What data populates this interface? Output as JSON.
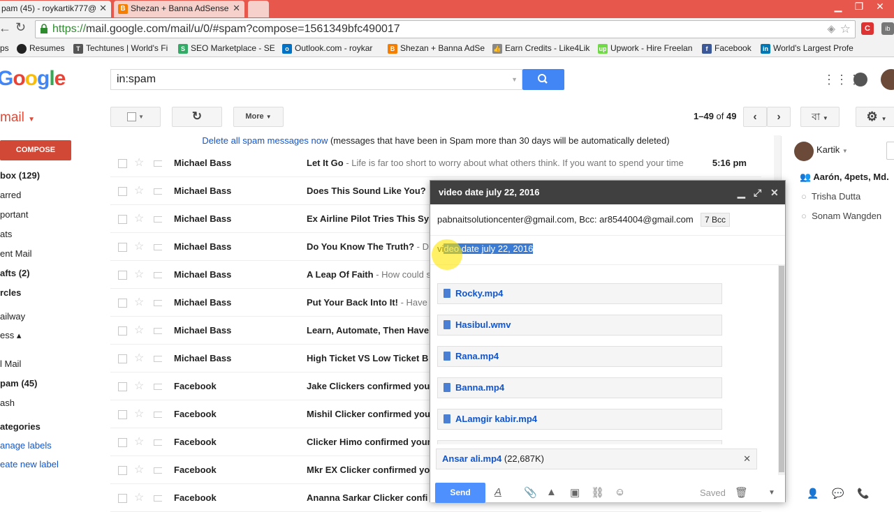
{
  "browser": {
    "tabs": [
      {
        "title": "pam (45) - roykartik777@"
      },
      {
        "title": "Shezan + Banna AdSense"
      },
      {
        "title": ""
      }
    ],
    "url_scheme": "https://",
    "url_rest": "mail.google.com/mail/u/0/#spam?compose=1561349bfc490017",
    "bookmarks": [
      {
        "label": "ps",
        "icon": "apps-icon"
      },
      {
        "label": "Resumes",
        "icon": "resumes-icon"
      },
      {
        "label": "Techtunes | World's Fi",
        "icon": "techtunes-icon"
      },
      {
        "label": "SEO Marketplace - SE",
        "icon": "seo-icon"
      },
      {
        "label": "Outlook.com - roykar",
        "icon": "outlook-icon"
      },
      {
        "label": "Shezan + Banna AdSe",
        "icon": "blogger-icon"
      },
      {
        "label": "Earn Credits - Like4Lik",
        "icon": "like-icon"
      },
      {
        "label": "Upwork - Hire Freelan",
        "icon": "upwork-icon"
      },
      {
        "label": "Facebook",
        "icon": "facebook-icon"
      },
      {
        "label": "World's Largest Profe",
        "icon": "linkedin-icon"
      }
    ]
  },
  "gmail": {
    "logo": "oogle",
    "product_label": "mail",
    "search_value": "in:spam",
    "toolbar": {
      "more": "More",
      "range": "1–49",
      "of": "of",
      "total": "49",
      "lang": "বা"
    },
    "compose_label": "COMPOSE",
    "nav": [
      {
        "label": "box (129)",
        "bold": true
      },
      {
        "label": "arred",
        "bold": false
      },
      {
        "label": "portant",
        "bold": false
      },
      {
        "label": "ats",
        "bold": false
      },
      {
        "label": "ent Mail",
        "bold": false
      },
      {
        "label": "afts (2)",
        "bold": true
      },
      {
        "label": "rcles",
        "bold": true
      },
      {
        "label": "ailway",
        "bold": false
      },
      {
        "label": "ess ▴",
        "bold": false
      },
      {
        "label": "l Mail",
        "bold": false
      },
      {
        "label": "pam (45)",
        "bold": true
      },
      {
        "label": "ash",
        "bold": false
      },
      {
        "label": "ategories",
        "bold": true
      },
      {
        "label": "anage labels",
        "link": true
      },
      {
        "label": "eate new label",
        "link": true
      }
    ],
    "notice": {
      "link": "Delete all spam messages now",
      "text": " (messages that have been in Spam more than 30 days will be automatically deleted)"
    },
    "emails": [
      {
        "sender": "Michael Bass",
        "subject": "Let It Go",
        "snippet": " - Life is far too short to worry about what others think. If you want to spend your time",
        "time": "5:16 pm"
      },
      {
        "sender": "Michael Bass",
        "subject": "Does This Sound Like You?",
        "snippet": "",
        "time": ""
      },
      {
        "sender": "Michael Bass",
        "subject": "Ex Airline Pilot Tries This Sy",
        "snippet": "",
        "time": ""
      },
      {
        "sender": "Michael Bass",
        "subject": "Do You Know The Truth?",
        "snippet": " - D",
        "time": ""
      },
      {
        "sender": "Michael Bass",
        "subject": "A Leap Of Faith",
        "snippet": " - How could s",
        "time": ""
      },
      {
        "sender": "Michael Bass",
        "subject": "Put Your Back Into It!",
        "snippet": " - Have",
        "time": ""
      },
      {
        "sender": "Michael Bass",
        "subject": "Learn, Automate, Then Have",
        "snippet": "",
        "time": ""
      },
      {
        "sender": "Michael Bass",
        "subject": "High Ticket VS Low Ticket B",
        "snippet": "",
        "time": ""
      },
      {
        "sender": "Facebook",
        "subject": "Jake Clickers confirmed you",
        "snippet": "",
        "time": ""
      },
      {
        "sender": "Facebook",
        "subject": "Mishil Clicker confirmed you",
        "snippet": "",
        "time": ""
      },
      {
        "sender": "Facebook",
        "subject": "Clicker Himo confirmed your",
        "snippet": "",
        "time": ""
      },
      {
        "sender": "Facebook",
        "subject": "Mkr EX Clicker confirmed yo",
        "snippet": "",
        "time": ""
      },
      {
        "sender": "Facebook",
        "subject": "Ananna Sarkar Clicker confi",
        "snippet": "",
        "time": ""
      }
    ],
    "chat": {
      "user": "Kartik",
      "group": "Aarón, 4pets, Md.",
      "contacts": [
        "Trisha Dutta",
        "Sonam Wangden"
      ]
    },
    "compose_window": {
      "title": "video date july 22, 2016",
      "recipients": "pabnaitsolutioncenter@gmail.com, Bcc: ar8544004@gmail.com",
      "bcc_chip": "7 Bcc",
      "subject_prefix": "vi",
      "subject_selected": "deo date july 22, 2016",
      "attachments": [
        "Rocky.mp4",
        "Hasibul.wmv",
        "Rana.mp4",
        "Banna.mp4",
        "ALamgir kabir.mp4"
      ],
      "uploading_name": "Ansar ali.mp4",
      "uploading_size": " (22,687K)",
      "send_label": "Send",
      "saved_label": "Saved"
    }
  }
}
